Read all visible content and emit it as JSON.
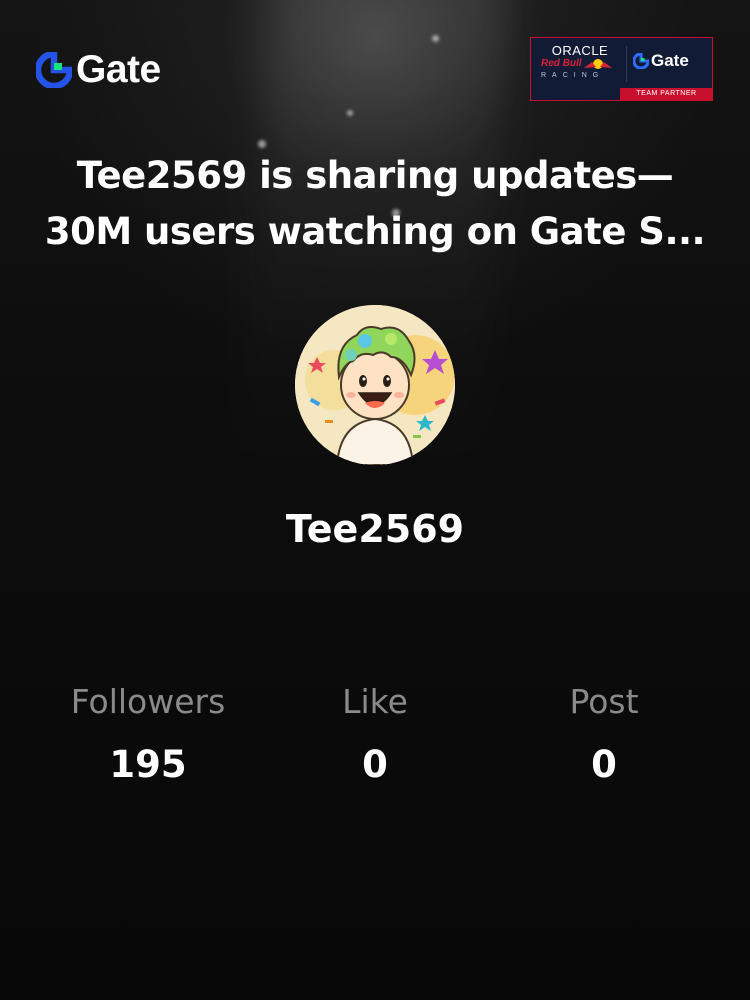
{
  "header": {
    "logo_text": "Gate",
    "brand_color": "#2354e6",
    "accent_green": "#17e37a"
  },
  "partner_badge": {
    "oracle": "ORACLE",
    "red_bull": "Red Bull",
    "racing": "RACING",
    "gate_text": "Gate",
    "strip": "TEAM PARTNER",
    "strip_color": "#c8102e",
    "bg_color": "#121b36"
  },
  "headline": {
    "line1": "Tee2569 is sharing updates—",
    "line2": "30M users watching on Gate S..."
  },
  "profile": {
    "avatar_icon": "cartoon-avatar",
    "username": "Tee2569"
  },
  "stats": [
    {
      "label": "Followers",
      "value": "195"
    },
    {
      "label": "Like",
      "value": "0"
    },
    {
      "label": "Post",
      "value": "0"
    }
  ]
}
